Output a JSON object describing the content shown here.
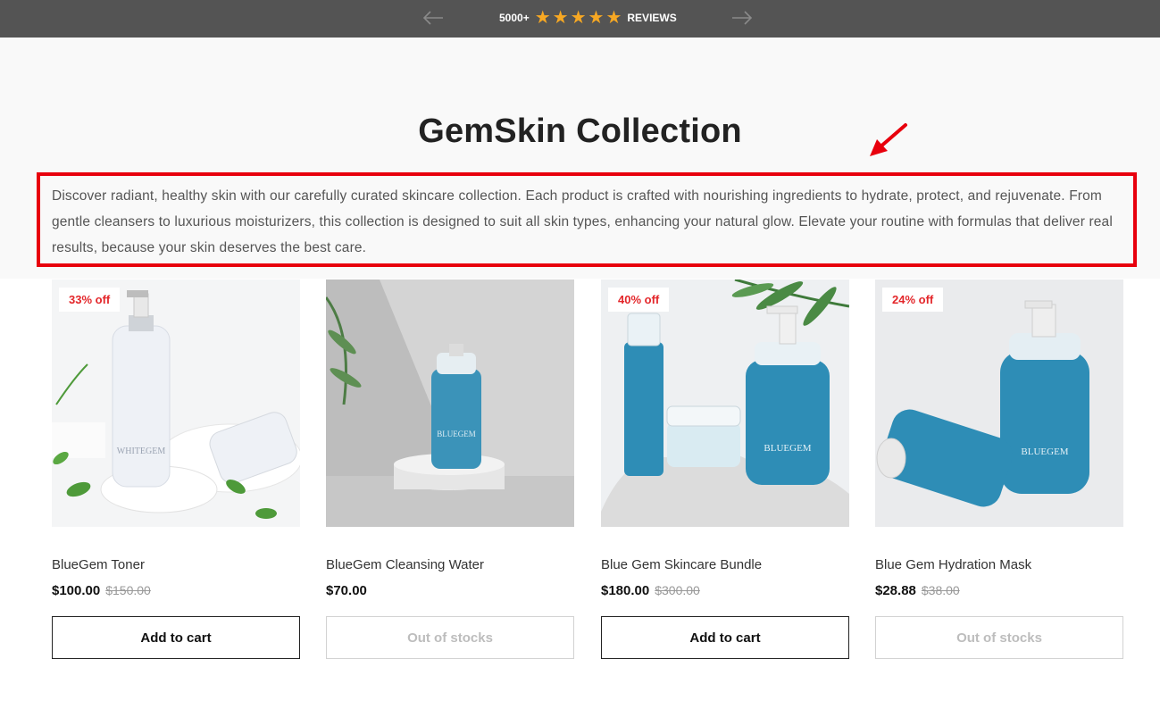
{
  "announcement": {
    "count_text": "5000+",
    "star_count": 5,
    "reviews_label": "REVIEWS",
    "star_color": "#f7a823"
  },
  "collection": {
    "title": "GemSkin Collection",
    "description": "Discover radiant, healthy skin with our carefully curated skincare collection. Each product is crafted with nourishing ingredients to hydrate, protect, and rejuvenate. From gentle cleansers to luxurious moisturizers, this collection is designed to suit all skin types, enhancing your natural glow. Elevate your routine with formulas that deliver real results, because your skin deserves the best care."
  },
  "products": [
    {
      "name": "BlueGem Toner",
      "price": "$100.00",
      "compare_price": "$150.00",
      "badge": "33% off",
      "button": "Add to cart",
      "in_stock": true,
      "bottle_label": "WHITEGEM"
    },
    {
      "name": "BlueGem Cleansing Water",
      "price": "$70.00",
      "compare_price": "",
      "badge": "",
      "button": "Out of stocks",
      "in_stock": false,
      "bottle_label": "BLUEGEM"
    },
    {
      "name": "Blue Gem Skincare Bundle",
      "price": "$180.00",
      "compare_price": "$300.00",
      "badge": "40% off",
      "button": "Add to cart",
      "in_stock": true,
      "bottle_label": "BLUEGEM"
    },
    {
      "name": "Blue Gem Hydration Mask",
      "price": "$28.88",
      "compare_price": "$38.00",
      "badge": "24% off",
      "button": "Out of stocks",
      "in_stock": false,
      "bottle_label": "BLUEGEM"
    }
  ],
  "colors": {
    "topbar": "#545454",
    "annotation_red": "#e8000d",
    "badge_red": "#e3262a",
    "product_blue": "#2e8db6"
  }
}
